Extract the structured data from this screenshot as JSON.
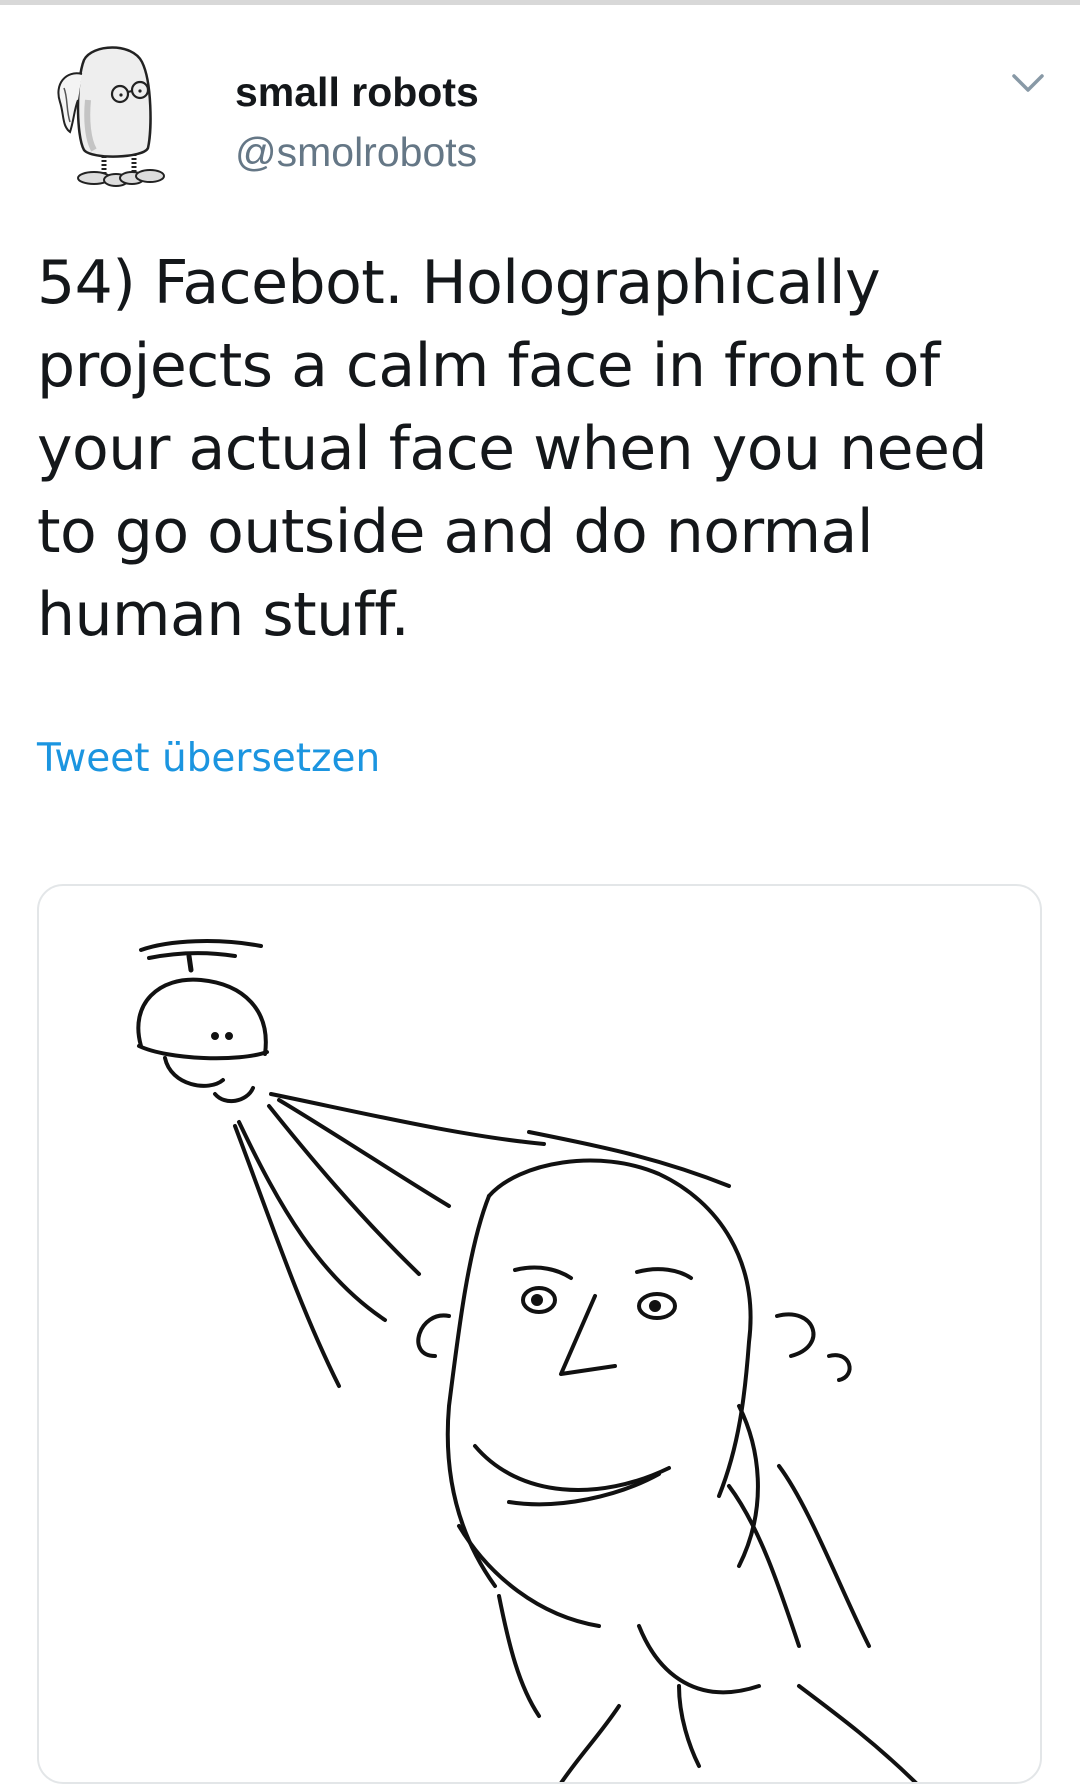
{
  "tweet": {
    "display_name": "small robots",
    "handle": "@smolrobots",
    "text": "54) Facebot. Holographically projects a calm face in front of your actual face when you need to go outside and do normal human stuff.",
    "translate_label": "Tweet übersetzen"
  },
  "icons": {
    "menu": "chevron-down-icon",
    "avatar": "robot-avatar"
  },
  "colors": {
    "text": "#14171a",
    "secondary": "#657786",
    "link": "#1b95e0",
    "card_border": "#e3e6e8"
  }
}
